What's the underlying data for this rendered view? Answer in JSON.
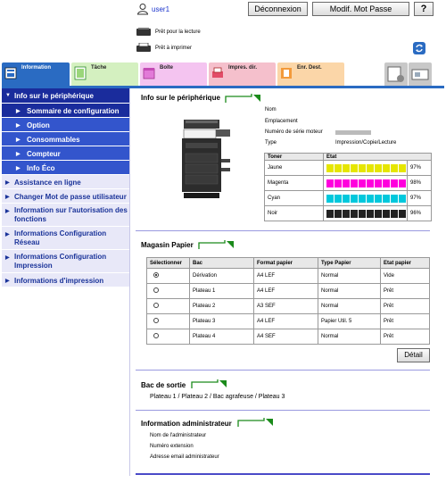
{
  "header": {
    "username": "user1",
    "logout_label": "Déconnexion",
    "change_password_label": "Modif. Mot Passe",
    "help_label": "?"
  },
  "status": {
    "scan": "Prêt pour la lecture",
    "print": "Prêt à imprimer"
  },
  "tabs": [
    {
      "label": "Information",
      "color": "#2a6bc2"
    },
    {
      "label": "Tâche",
      "color": "#d4f0c0"
    },
    {
      "label": "Boîte",
      "color": "#f4c4f0"
    },
    {
      "label": "Impres. dir.",
      "color": "#f5c0cc"
    },
    {
      "label": "Enr. Dest.",
      "color": "#fbd6a8"
    }
  ],
  "sidebar": {
    "items": [
      {
        "label": "Info sur le périphérique"
      },
      {
        "label": "Sommaire de configuration"
      },
      {
        "label": "Option"
      },
      {
        "label": "Consommables"
      },
      {
        "label": "Compteur"
      },
      {
        "label": "Info Éco"
      },
      {
        "label": "Assistance en ligne"
      },
      {
        "label": "Changer Mot de passe utilisateur"
      },
      {
        "label": "Information sur l'autorisation des fonctions"
      },
      {
        "label": "Informations Configuration Réseau"
      },
      {
        "label": "Informations Configuration Impression"
      },
      {
        "label": "Informations d'impression"
      }
    ]
  },
  "device": {
    "title": "Info sur le périphérique",
    "fields": [
      {
        "label": "Nom",
        "value": ""
      },
      {
        "label": "Emplacement",
        "value": ""
      },
      {
        "label": "Numéro de série moteur",
        "value": ""
      },
      {
        "label": "Type",
        "value": "Impression/Copie/Lecture"
      }
    ],
    "toner_header": {
      "col1": "Toner",
      "col2": "Etat"
    },
    "toner": [
      {
        "name": "Jaune",
        "percent": "97%",
        "level": 0.97,
        "color": "#e6e600"
      },
      {
        "name": "Magenta",
        "percent": "98%",
        "level": 0.98,
        "color": "#ff00dd"
      },
      {
        "name": "Cyan",
        "percent": "97%",
        "level": 0.97,
        "color": "#00c8dc"
      },
      {
        "name": "Noir",
        "percent": "96%",
        "level": 0.96,
        "color": "#222222"
      }
    ]
  },
  "paper": {
    "title": "Magasin Papier",
    "headers": [
      "Sélectionner",
      "Bac",
      "Format papier",
      "Type Papier",
      "Etat papier"
    ],
    "rows": [
      {
        "selected": true,
        "tray": "Dérivation",
        "size": "A4 LEF",
        "type": "Normal",
        "state": "Vide"
      },
      {
        "selected": false,
        "tray": "Plateau 1",
        "size": "A4 LEF",
        "type": "Normal",
        "state": "Prêt"
      },
      {
        "selected": false,
        "tray": "Plateau 2",
        "size": "A3 SEF",
        "type": "Normal",
        "state": "Prêt"
      },
      {
        "selected": false,
        "tray": "Plateau 3",
        "size": "A4 LEF",
        "type": "Papier Util. 5",
        "state": "Prêt"
      },
      {
        "selected": false,
        "tray": "Plateau 4",
        "size": "A4 SEF",
        "type": "Normal",
        "state": "Prêt"
      }
    ],
    "detail_label": "Détail"
  },
  "output": {
    "title": "Bac de sortie",
    "value": "Plateau 1 / Plateau 2 / Bac agrafeuse / Plateau 3"
  },
  "admin": {
    "title": "Information administrateur",
    "fields": [
      {
        "label": "Nom de l'administrateur"
      },
      {
        "label": "Numéro extension"
      },
      {
        "label": "Adresse email administrateur"
      }
    ]
  }
}
